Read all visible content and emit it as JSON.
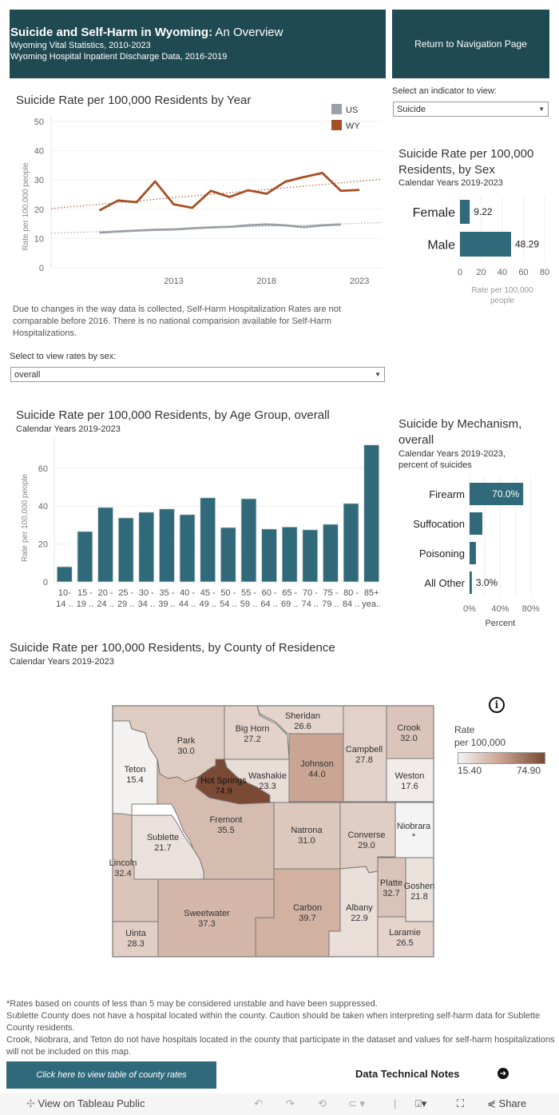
{
  "header": {
    "title_bold": "Suicide and Self-Harm in Wyoming:",
    "title_rest": " An Overview",
    "sub1": "Wyoming Vital Statistics, 2010-2023",
    "sub2": "Wyoming Hospital Inpatient Discharge Data, 2016-2019",
    "nav_button": "Return to Navigation Page"
  },
  "indicator": {
    "label": "Select an indicator to view:",
    "value": "Suicide"
  },
  "sex_filter": {
    "label": "Select to view rates by sex:",
    "value": "overall"
  },
  "data_note": "Due to changes in the way data is collected, Self-Harm Hospitalization Rates are not comparable before 2016. There is no national comparision available for Self-Harm Hospitalizations.",
  "colors": {
    "header_bg": "#204a52",
    "bar": "#306a7a",
    "wy": "#a64f25",
    "us": "#9ca0a6",
    "map_low": "#f4f2f0",
    "map_high": "#7a4a35"
  },
  "chart_data": [
    {
      "id": "by_year",
      "type": "line",
      "title": "Suicide Rate per 100,000 Residents by Year",
      "ylabel": "Rate per 100,000 people",
      "xlabel": "",
      "ylim": [
        0,
        50
      ],
      "yticks": [
        "0",
        "10",
        "20",
        "30",
        "40",
        "50"
      ],
      "xticks": [
        "2013",
        "2018",
        "2023"
      ],
      "x": [
        2009,
        2010,
        2011,
        2012,
        2013,
        2014,
        2015,
        2016,
        2017,
        2018,
        2019,
        2020,
        2021,
        2022,
        2023
      ],
      "legend": [
        "US",
        "WY"
      ],
      "legend_position": "top-right",
      "grid": true,
      "trendlines": true,
      "series": [
        {
          "name": "US",
          "values": [
            12.0,
            12.4,
            12.7,
            13.0,
            13.1,
            13.5,
            13.8,
            14.0,
            14.5,
            14.8,
            14.5,
            13.9,
            14.5,
            14.8,
            null
          ]
        },
        {
          "name": "WY",
          "values": [
            19.6,
            23.0,
            22.4,
            29.5,
            21.7,
            20.5,
            26.3,
            24.2,
            26.5,
            25.3,
            29.4,
            31.0,
            32.4,
            26.3,
            26.6
          ]
        }
      ]
    },
    {
      "id": "by_sex",
      "type": "bar",
      "orientation": "horizontal",
      "title": "Suicide Rate per 100,000 Residents, by Sex",
      "subtitle": "Calendar Years 2019-2023",
      "categories": [
        "Female",
        "Male"
      ],
      "values": [
        9.22,
        48.29
      ],
      "labels": [
        "9.22",
        "48.29"
      ],
      "xlabel": "Rate per 100,000 people",
      "xlim": [
        0,
        80
      ],
      "xticks": [
        "0",
        "20",
        "40",
        "60",
        "80"
      ]
    },
    {
      "id": "by_age",
      "type": "bar",
      "title": "Suicide Rate per 100,000 Residents, by Age Group, overall",
      "subtitle": "Calendar Years 2019-2023",
      "ylabel": "Rate per 100,000 people",
      "ylim": [
        0,
        75
      ],
      "yticks": [
        "0",
        "20",
        "40",
        "60"
      ],
      "categories": [
        [
          "10-",
          "14 .."
        ],
        [
          "15 -",
          "19 .."
        ],
        [
          "20 -",
          "24 .."
        ],
        [
          "25 -",
          "29 .."
        ],
        [
          "30 -",
          "34 .."
        ],
        [
          "35 -",
          "39 .."
        ],
        [
          "40 -",
          "44 .."
        ],
        [
          "45 -",
          "49 .."
        ],
        [
          "50 -",
          "54 .."
        ],
        [
          "55 -",
          "59 .."
        ],
        [
          "60 -",
          "64 .."
        ],
        [
          "65 -",
          "69 .."
        ],
        [
          "70 -",
          "74 .."
        ],
        [
          "75 -",
          "79 .."
        ],
        [
          "80 -",
          "84 .."
        ],
        [
          "85+",
          "yea.."
        ]
      ],
      "values": [
        8.0,
        26.6,
        39.3,
        33.8,
        36.8,
        38.5,
        35.5,
        44.4,
        28.7,
        43.9,
        27.9,
        29.0,
        27.5,
        30.4,
        41.4,
        72.3
      ]
    },
    {
      "id": "by_mechanism",
      "type": "bar",
      "orientation": "horizontal",
      "title": "Suicide by Mechanism, overall",
      "subtitle": "Calendar Years 2019-2023, percent of suicides",
      "categories": [
        "Firearm",
        "Suffocation",
        "Poisoning",
        "All Other"
      ],
      "values": [
        70.0,
        16.7,
        8.3,
        3.0
      ],
      "labels": [
        "70.0%",
        "",
        "",
        "3.0%"
      ],
      "xlabel": "Percent",
      "xlim": [
        0,
        100
      ],
      "xticks": [
        "0%",
        "40%",
        "80%"
      ]
    }
  ],
  "map": {
    "title": "Suicide Rate per 100,000 Residents, by County of Residence",
    "subtitle": "Calendar Years 2019-2023",
    "legend_title1": "Rate",
    "legend_title2": "per 100,000",
    "legend_min": "15.40",
    "legend_max": "74.90",
    "min": 15.4,
    "max": 74.9,
    "counties": [
      {
        "name": "Park",
        "value": "30.0",
        "rate": 30.0
      },
      {
        "name": "Big Horn",
        "value": "27.2",
        "rate": 27.2
      },
      {
        "name": "Sheridan",
        "value": "26.6",
        "rate": 26.6
      },
      {
        "name": "Campbell",
        "value": "27.8",
        "rate": 27.8
      },
      {
        "name": "Crook",
        "value": "32.0",
        "rate": 32.0
      },
      {
        "name": "Teton",
        "value": "15.4",
        "rate": 15.4
      },
      {
        "name": "Hot Springs",
        "value": "74.9",
        "rate": 74.9
      },
      {
        "name": "Washakie",
        "value": "23.3",
        "rate": 23.3
      },
      {
        "name": "Johnson",
        "value": "44.0",
        "rate": 44.0
      },
      {
        "name": "Weston",
        "value": "17.6",
        "rate": 17.6
      },
      {
        "name": "Fremont",
        "value": "35.5",
        "rate": 35.5
      },
      {
        "name": "Natrona",
        "value": "31.0",
        "rate": 31.0
      },
      {
        "name": "Converse",
        "value": "29.0",
        "rate": 29.0
      },
      {
        "name": "Niobrara",
        "value": "*",
        "rate": null
      },
      {
        "name": "Sublette",
        "value": "21.7",
        "rate": 21.7
      },
      {
        "name": "Lincoln",
        "value": "32.4",
        "rate": 32.4
      },
      {
        "name": "Sweetwater",
        "value": "37.3",
        "rate": 37.3
      },
      {
        "name": "Carbon",
        "value": "39.7",
        "rate": 39.7
      },
      {
        "name": "Albany",
        "value": "22.9",
        "rate": 22.9
      },
      {
        "name": "Platte",
        "value": "32.7",
        "rate": 32.7
      },
      {
        "name": "Goshen",
        "value": "21.8",
        "rate": 21.8
      },
      {
        "name": "Uinta",
        "value": "28.3",
        "rate": 28.3
      },
      {
        "name": "Laramie",
        "value": "26.5",
        "rate": 26.5
      }
    ]
  },
  "footnotes": [
    "*Rates based on counts of less than 5 may be considered unstable and have been suppressed.",
    "Sublette County does not have a hospital located within the county. Caution should be taken when interpreting self-harm data for Sublette County residents.",
    "Crook, Niobrara, and Teton do not have hospitals located in the county that participate in the dataset and values for self-harm hospitalizations will not be included on this map."
  ],
  "buttons": {
    "county_table": "Click here to view table of county rates",
    "tech_notes": "Data Technical Notes"
  },
  "toolbar": {
    "view_on": "View on Tableau Public",
    "share": "Share"
  }
}
